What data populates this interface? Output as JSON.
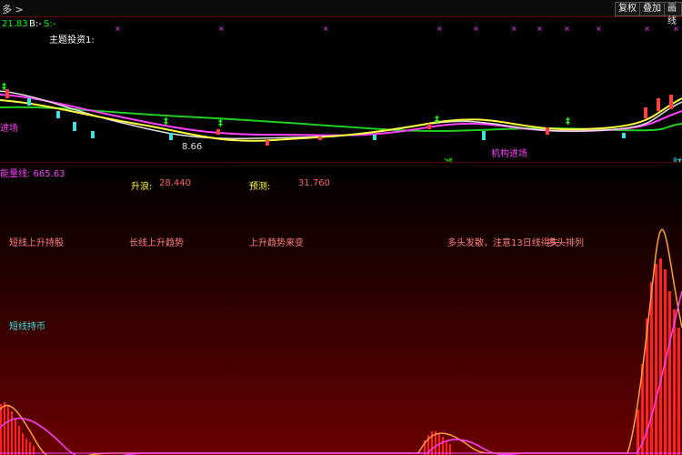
{
  "toolbar": {
    "menu_label": "多 >",
    "buttons": [
      "复权",
      "叠加",
      "画线"
    ]
  },
  "price_panel": {
    "readout_a": "21.83",
    "readout_b_label": "B:-",
    "readout_s_label": "S:-",
    "title": "主题投资1:",
    "annotations": {
      "enter": "进场",
      "low_price": "8.66",
      "reduce": "减",
      "institution_enter": "机构进场",
      "right_label": "财"
    }
  },
  "indicator_panel": {
    "energy_label": "能量线: 665.63",
    "rise_label": "升浪:",
    "rise_value": "28.440",
    "forecast_label": "预测:",
    "forecast_value": "31.760",
    "signals": [
      "短线上升持股",
      "长线上升趋势",
      "上升趋势来变",
      "多头发散，注意13日线得失",
      "多头排列",
      "短线持币"
    ]
  },
  "colors": {
    "accent_red": "#ff2020",
    "panel_border": "#6a0000",
    "candle_up": "#ff4040",
    "candle_down": "#40e0e0",
    "ma_white": "#e0e0e0",
    "ma_yellow": "#ffff40",
    "ma_magenta": "#ff40ff",
    "ma_green": "#20d020"
  }
}
